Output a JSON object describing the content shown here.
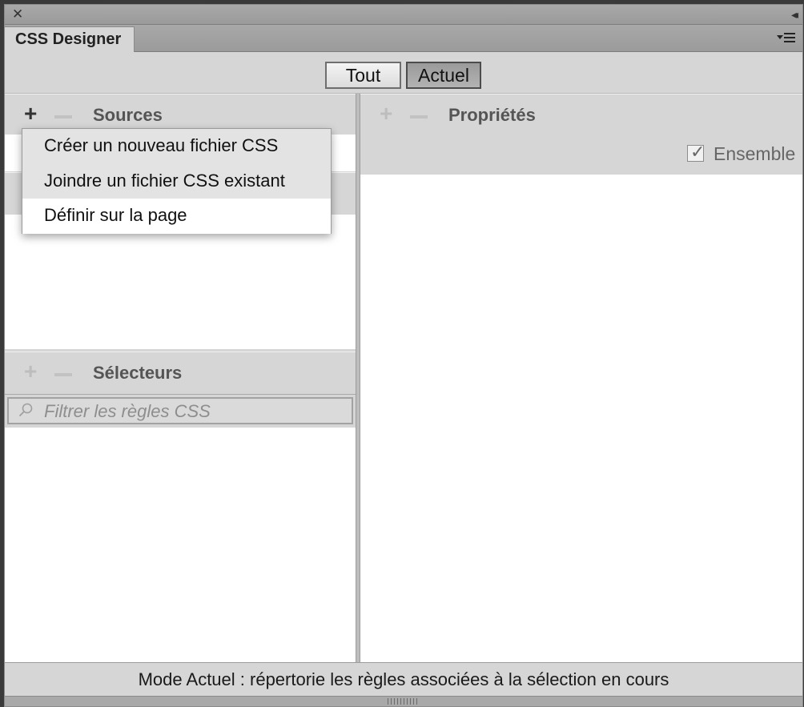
{
  "window": {
    "close_icon": "close-icon",
    "collapse_icon": "collapse-double-arrow-icon"
  },
  "tab": {
    "label": "CSS Designer"
  },
  "panel_menu": {
    "icon": "panel-menu-icon"
  },
  "mode": {
    "tout_label": "Tout",
    "actuel_label": "Actuel",
    "active": "Actuel"
  },
  "sources": {
    "title": "Sources",
    "plus": "+",
    "menu": [
      {
        "label": "Créer un nouveau fichier CSS"
      },
      {
        "label": "Joindre un fichier CSS existant"
      },
      {
        "label": "Définir sur la page"
      }
    ]
  },
  "selecteurs": {
    "title": "Sélecteurs",
    "plus": "+",
    "filter_placeholder": "Filtrer les règles CSS"
  },
  "proprietes": {
    "title": "Propriétés",
    "plus": "+",
    "ensemble_label": "Ensemble",
    "ensemble_checked": true
  },
  "footer": {
    "status": "Mode Actuel : répertorie les règles associées à la sélection en cours"
  },
  "colors": {
    "panel_bg": "#d6d6d6",
    "header_bg": "#a9a9a9",
    "content_bg": "#ffffff"
  }
}
